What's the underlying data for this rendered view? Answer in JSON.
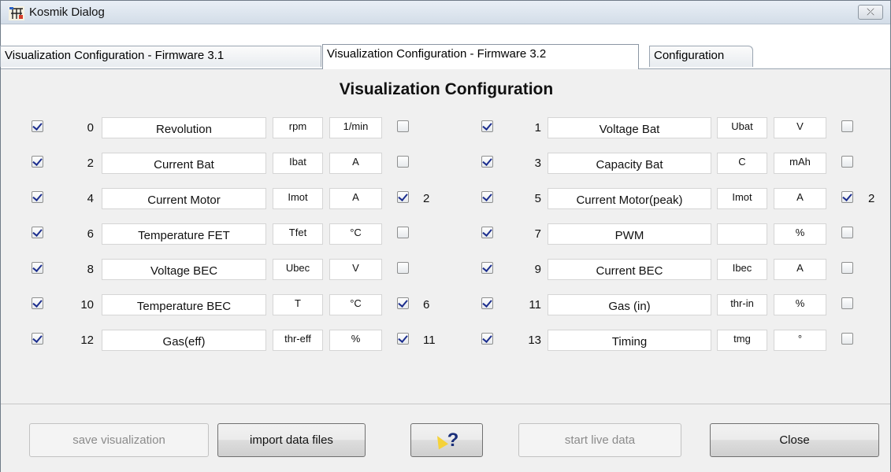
{
  "window": {
    "title": "Kosmik Dialog",
    "close_label": "⤫"
  },
  "tabs": [
    {
      "label": "Visualization Configuration - Firmware 3.1",
      "active": false
    },
    {
      "label": "Visualization Configuration - Firmware 3.2",
      "active": true
    },
    {
      "label": "Configuration",
      "active": false
    }
  ],
  "heading": "Visualization Configuration",
  "rows": [
    {
      "checked": true,
      "index": "0",
      "name": "Revolution",
      "symbol": "rpm",
      "unit": "1/min",
      "ref_checked": false,
      "ref": ""
    },
    {
      "checked": true,
      "index": "1",
      "name": "Voltage Bat",
      "symbol": "Ubat",
      "unit": "V",
      "ref_checked": false,
      "ref": ""
    },
    {
      "checked": true,
      "index": "2",
      "name": "Current Bat",
      "symbol": "Ibat",
      "unit": "A",
      "ref_checked": false,
      "ref": ""
    },
    {
      "checked": true,
      "index": "3",
      "name": "Capacity Bat",
      "symbol": "C",
      "unit": "mAh",
      "ref_checked": false,
      "ref": ""
    },
    {
      "checked": true,
      "index": "4",
      "name": "Current Motor",
      "symbol": "Imot",
      "unit": "A",
      "ref_checked": true,
      "ref": "2"
    },
    {
      "checked": true,
      "index": "5",
      "name": "Current Motor(peak)",
      "symbol": "Imot",
      "unit": "A",
      "ref_checked": true,
      "ref": "2"
    },
    {
      "checked": true,
      "index": "6",
      "name": "Temperature FET",
      "symbol": "Tfet",
      "unit": "°C",
      "ref_checked": false,
      "ref": ""
    },
    {
      "checked": true,
      "index": "7",
      "name": "PWM",
      "symbol": "",
      "unit": "%",
      "ref_checked": false,
      "ref": ""
    },
    {
      "checked": true,
      "index": "8",
      "name": "Voltage BEC",
      "symbol": "Ubec",
      "unit": "V",
      "ref_checked": false,
      "ref": ""
    },
    {
      "checked": true,
      "index": "9",
      "name": "Current BEC",
      "symbol": "Ibec",
      "unit": "A",
      "ref_checked": false,
      "ref": ""
    },
    {
      "checked": true,
      "index": "10",
      "name": "Temperature BEC",
      "symbol": "T",
      "unit": "°C",
      "ref_checked": true,
      "ref": "6"
    },
    {
      "checked": true,
      "index": "11",
      "name": "Gas (in)",
      "symbol": "thr-in",
      "unit": "%",
      "ref_checked": false,
      "ref": ""
    },
    {
      "checked": true,
      "index": "12",
      "name": "Gas(eff)",
      "symbol": "thr-eff",
      "unit": "%",
      "ref_checked": true,
      "ref": "11"
    },
    {
      "checked": true,
      "index": "13",
      "name": "Timing",
      "symbol": "tmg",
      "unit": "°",
      "ref_checked": false,
      "ref": ""
    }
  ],
  "buttons": {
    "save": {
      "label": "save visualization",
      "enabled": false
    },
    "import": {
      "label": "import data files",
      "enabled": true
    },
    "help": {
      "label": "?",
      "icon": "help-pointer-icon",
      "enabled": true
    },
    "live": {
      "label": "start live data",
      "enabled": false
    },
    "close": {
      "label": "Close",
      "enabled": true
    }
  }
}
